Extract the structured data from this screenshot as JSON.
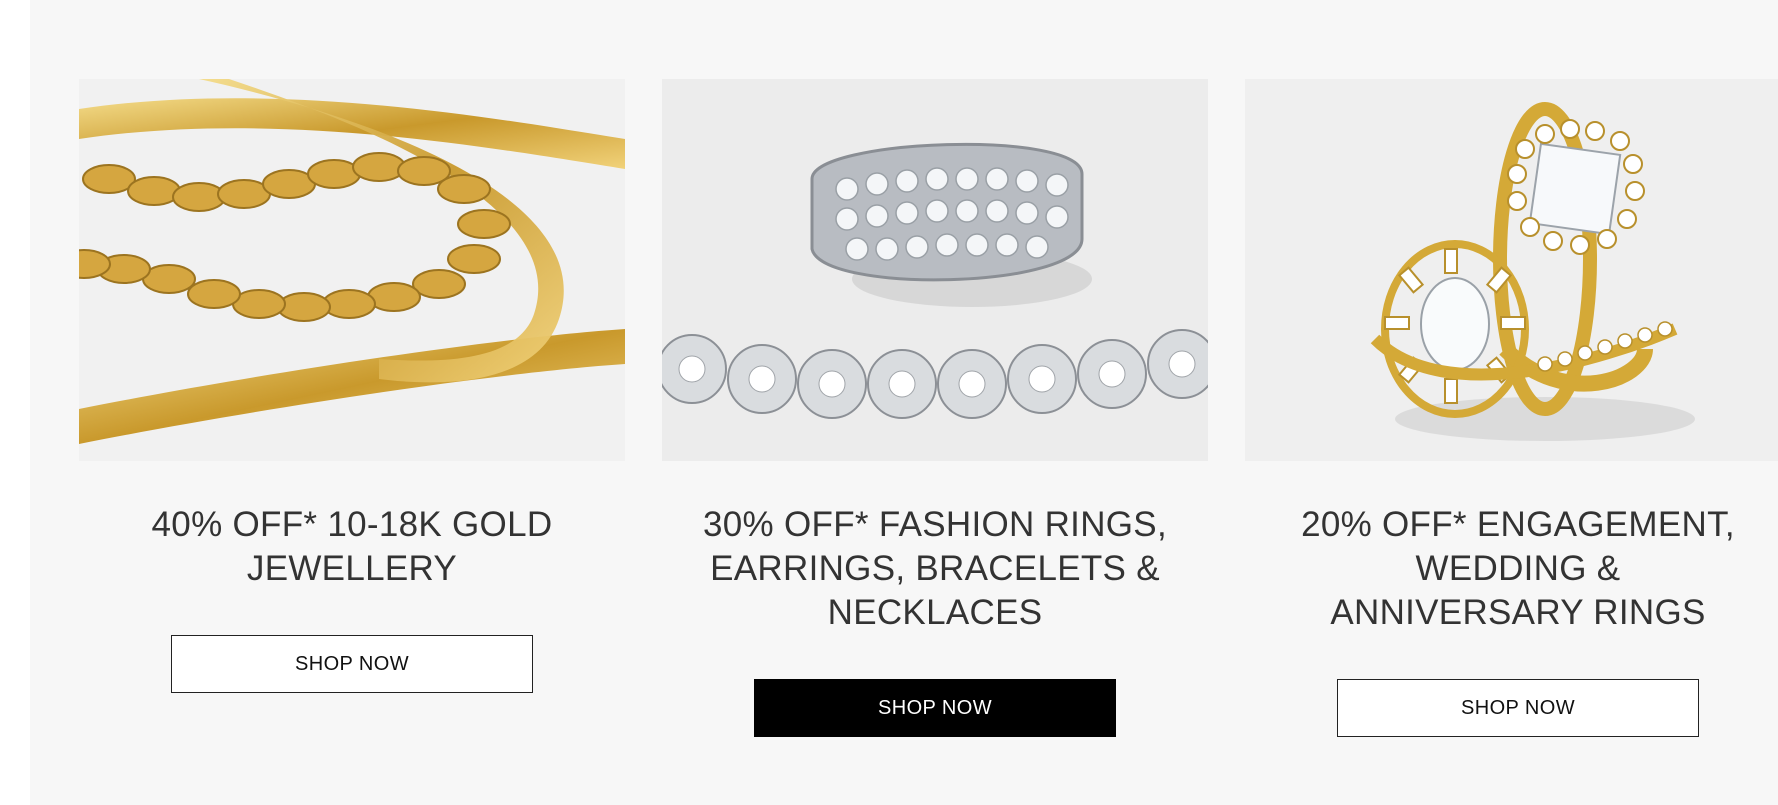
{
  "promos": [
    {
      "heading": "40% OFF* 10-18K GOLD JEWELLERY",
      "button_label": "SHOP NOW",
      "image_subject": "gold-chains-image"
    },
    {
      "heading": "30% OFF* FASHION RINGS, EARRINGS, BRACELETS & NECKLACES",
      "button_label": "SHOP NOW",
      "image_subject": "diamond-ring-bracelet-image"
    },
    {
      "heading": "20% OFF* ENGAGEMENT, WEDDING & ANNIVERSARY RINGS",
      "button_label": "SHOP NOW",
      "image_subject": "engagement-rings-image"
    }
  ],
  "colors": {
    "panel_bg": "#f7f7f7",
    "heading_text": "#333333",
    "button_dark": "#000000",
    "gold": "#d4a937",
    "silver": "#cfd2d6"
  }
}
